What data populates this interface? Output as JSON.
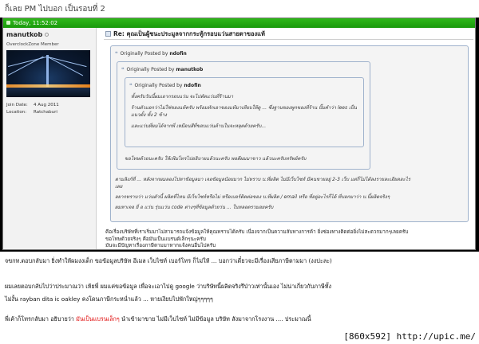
{
  "thread_line": "ก็เลย PM ไปบอก เป็นรอบที่ 2",
  "post": {
    "date": "Today, 11:52:02",
    "title": "Re: คุณเป็นผู้ชนะประมูลจากกระทู้กรอบแว่นสายตาของแท้"
  },
  "user": {
    "name": "manutkob",
    "title": "OverclockZone Member",
    "join_label": "Join Date:",
    "join_value": "4 Aug 2011",
    "location_label": "Location:",
    "location_value": "Ratchaburi"
  },
  "quotes": {
    "q1_head": "Originally Posted by",
    "q1_author": "ndofin",
    "q2_head": "Originally Posted by",
    "q2_author": "manutkob",
    "q3_head": "Originally Posted by",
    "q3_author": "ndofin",
    "q3_lines": [
      "ทั้งครับวันนี้ผมเอากรอบแว่น จะไปตัดแว่นที่ร้านมา",
      "ร้านตัวแอกว่าไม่ใช่ของแท้ครับ พร้อมทักเอาของแท้มาเทียบให้ดู ... ซึ่งฐานของพูกของที่ร้าน ปั๊มคำว่า lees เป็น",
      "แนวตั้ง ทั้ง 2 ข้าง",
      "และแว่นที่ผมได้จากพี่ เหมือนสีที่ขอบแว่นด้านในจะหลุดด้วยครับ..."
    ],
    "q2_text": "ขอโทษด้วยนะครับ ให้เฟ้มโทรไปอธิบายแล้วนะครับ พอดีผมมาขาว แล้วนะครับทรัพย์ครับ",
    "q1_lines": [
      "ตามลิงก์ที่ ... หลังจากผมลองไปหาข้อมูลมา เจอข้อมูลน้อยมาก ไม่ทราบ บ.ที่ผลิต ไม่มีเว็บไซท์ มีคนขายอยู่ 2-3 เว็บ แต่ก็ไม่ได้ลงรายละเอียดอะไร",
      "เลย",
      "อยากทราบว่า แว่นตัวนี้ ผลิตที่ไหน มีเว็บไซท์หรือไม่ หรือเบอร์ติดต่อของ บ.ที่ผลิต / email หรือ ที่อยู่อะไรก็ได้ ที่บอกมาว่า บ.นี้ผลิตจริงๆ",
      "ผมหาเจอ ยี่ อ แว่น รุ่นแว่น code ต่างๆที่ข้อมูลด้วยว่น ... ในหลอดรวมอยครับ"
    ]
  },
  "reply_lines": [
    "คือเรื่องบริษัทที่เราเริ่มมาไม่สามารถแจ้งข้อมูลให้คุณทราบได้ครับ เนื่องจากเป็นความลับทางการค้า ยิ่งช่องทางติดต่อยิ่งไม่สะดวกมากๆเลยครับ",
    "ขอโทษด้วยจริงๆ คือมันเป็นแบรนด์เล็กๆนะครับ",
    "มันจะมีปัญหาเรื่องภาษีตามมาหากแจ้งคนอื่นไปครับ"
  ],
  "below": {
    "line1": "จขกท.ตอบกลับมา ยิ่งทำให้ผมงงเด็ก ขอข้อมูลบริษัท อีเมล เว็บไซท์ เบอร์โทร ก็ไม่ให้ ... บอกว่าเดี๋ยวจะมีเรื่องเสียภาษีตามมา (งงปะละ)",
    "line2": "ผมเลยตอบกลับไปว่าประมาณว่า เห้ยพี่ ผมแค่ขอข้อมูล เพื่อจะเอาไปดู google ว่าบริษัทนี้ผลิตจริงรึป่าวเท่านั้นเอง ไม่น่าเกี่ยวกับภาษีทั้ง",
    "line3": "ไม่งั้น rayban dita ic oakley คงโดนภาษีกระหน่ำแล้ว ... หายเงียบไปพักใหญ่ๆๆๆๆๆ",
    "line4_a": "พี่เค้าก็โทรกลับมา อธิบายว่า ",
    "line4_red": "มันเป็นแบรนเล็กๆ",
    "line4_b": " นำเข้ามาขาย ไม่มีเว็บไซท์ ไม่มีข้อมูล บริษัท สังมาจากโรงงาน .... ประมาณนี้"
  },
  "watermark": "[860x592] http://upic.me/"
}
